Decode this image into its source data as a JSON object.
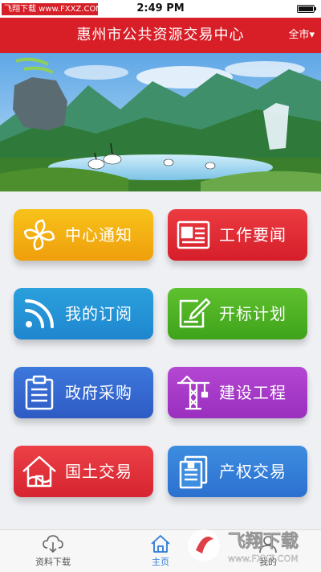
{
  "status_bar": {
    "watermark": "飞翔下载 www.FXXZ.COM",
    "time": "2:49 PM",
    "battery_level": 1.0
  },
  "header": {
    "title": "惠州市公共资源交易中心",
    "region": "全市▾"
  },
  "banner": {
    "slide_count": 3,
    "active_slide": 3
  },
  "tiles": [
    {
      "label": "中心通知",
      "icon": "pinwheel-icon",
      "color": "#f4b015"
    },
    {
      "label": "工作要闻",
      "icon": "newspaper-icon",
      "color": "#e02a34"
    },
    {
      "label": "我的订阅",
      "icon": "rss-icon",
      "color": "#2597d8"
    },
    {
      "label": "开标计划",
      "icon": "edit-pen-icon",
      "color": "#4cb125"
    },
    {
      "label": "政府采购",
      "icon": "clipboard-list-icon",
      "color": "#356ad0"
    },
    {
      "label": "建设工程",
      "icon": "tower-crane-icon",
      "color": "#a83bc8"
    },
    {
      "label": "国土交易",
      "icon": "house-land-icon",
      "color": "#e0323b"
    },
    {
      "label": "产权交易",
      "icon": "documents-icon",
      "color": "#347ed8"
    }
  ],
  "tabbar": {
    "items": [
      {
        "label": "资料下载",
        "icon": "cloud-download-icon"
      },
      {
        "label": "主页",
        "icon": "home-icon"
      },
      {
        "label": "我的",
        "icon": "user-icon"
      }
    ],
    "active": "主页"
  },
  "overlay_watermark": {
    "brand": "飞翔下载",
    "url": "www.FXXZ.COM"
  }
}
